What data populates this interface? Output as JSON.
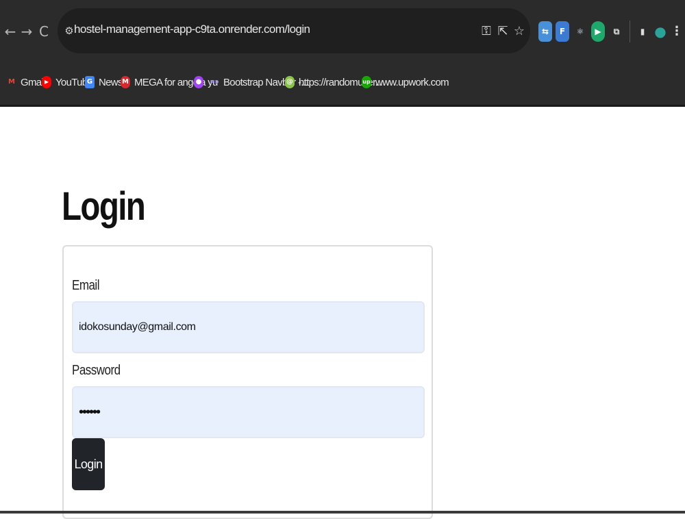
{
  "browser": {
    "url": "hostel-management-app-c9ta.onrender.com/login",
    "nav": {
      "back_icon": "←",
      "forward_icon": "→",
      "reload_icon": "C"
    },
    "site_info_icon": "⚙",
    "omnibox_icons": {
      "key": "⚿",
      "share": "⇱",
      "star": "☆"
    },
    "extensions": [
      {
        "name": "ext-1",
        "glyph": "⇆",
        "color": "#4a90d9"
      },
      {
        "name": "ext-2",
        "glyph": "F",
        "color": "#3b7bd4"
      },
      {
        "name": "ext-react",
        "glyph": "⚛",
        "color": "#2b2b2b"
      },
      {
        "name": "ext-green",
        "glyph": "▶",
        "color": "#1ea86b"
      },
      {
        "name": "ext-puzzle",
        "glyph": "⧉",
        "color": "#2b2b2b"
      }
    ],
    "sidepanel_icon": "▮",
    "profile_icon": "●",
    "menu_icon": "⋮"
  },
  "bookmarks": [
    {
      "label": "Gmail",
      "icon_color": "#ea4335",
      "glyph": "M"
    },
    {
      "label": "YouTube",
      "icon_color": "#ff0000",
      "glyph": "▶"
    },
    {
      "label": "News",
      "icon_color": "#4285f4",
      "glyph": "G"
    },
    {
      "label": "MEGA for angela yu",
      "icon_color": "#d9272e",
      "glyph": "M"
    },
    {
      "label": "",
      "icon_color": "#a142f4",
      "glyph": "●"
    },
    {
      "label": "Bootstrap Navbar -...",
      "icon_color": "#7952b3",
      "glyph": "MD"
    },
    {
      "label": "https://randomuser...",
      "icon_color": "#8bc34a",
      "glyph": "@"
    },
    {
      "label": "www.upwork.com",
      "icon_color": "#14a800",
      "glyph": "up"
    }
  ],
  "page": {
    "title": "Login",
    "email_label": "Email",
    "email_value": "idokosunday@gmail.com",
    "password_label": "Password",
    "password_value": "••••••",
    "login_button": "Login"
  }
}
